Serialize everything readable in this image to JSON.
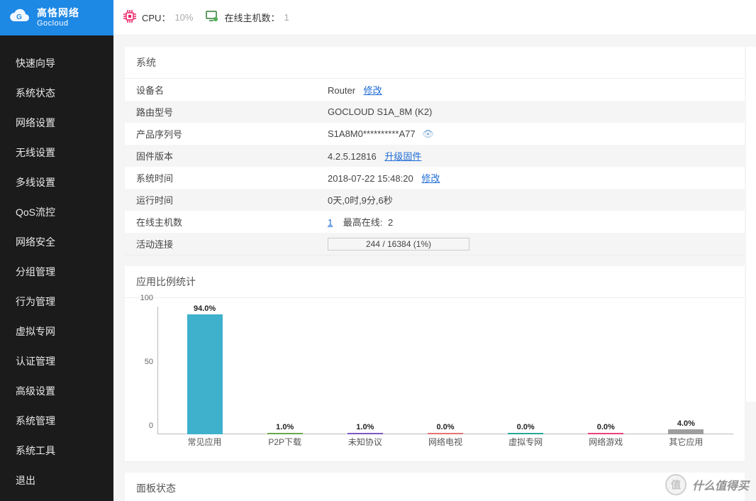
{
  "brand": {
    "cn": "高恪网络",
    "en": "Gocloud"
  },
  "topbar": {
    "cpu_label": "CPU：",
    "cpu_value": "10%",
    "online_label": "在线主机数：",
    "online_value": "1"
  },
  "sidebar": {
    "items": [
      "快速向导",
      "系统状态",
      "网络设置",
      "无线设置",
      "多线设置",
      "QoS流控",
      "网络安全",
      "分组管理",
      "行为管理",
      "虚拟专网",
      "认证管理",
      "高级设置",
      "系统管理",
      "系统工具",
      "退出"
    ]
  },
  "panels": {
    "system_title": "系统",
    "app_stats_title": "应用比例统计",
    "panel_status_title": "面板状态"
  },
  "system": {
    "rows": {
      "device_name_k": "设备名",
      "device_name_v": "Router",
      "device_name_edit": "修改",
      "model_k": "路由型号",
      "model_v": "GOCLOUD S1A_8M (K2)",
      "serial_k": "产品序列号",
      "serial_v": "S1A8M0**********A77",
      "fw_k": "固件版本",
      "fw_v": "4.2.5.12816",
      "fw_upgrade": "升级固件",
      "systime_k": "系统时间",
      "systime_v": "2018-07-22 15:48:20",
      "systime_edit": "修改",
      "uptime_k": "运行时间",
      "uptime_v": "0天,0时,9分,6秒",
      "online_k": "在线主机数",
      "online_v": "1",
      "online_max_label": "最高在线:",
      "online_max_v": "2",
      "conn_k": "活动连接",
      "conn_v": "244 / 16384 (1%)"
    }
  },
  "chart_data": {
    "type": "bar",
    "title": "应用比例统计",
    "ylabel": "",
    "ylim": [
      0,
      100
    ],
    "yticks": [
      0,
      50,
      100
    ],
    "categories": [
      "常见应用",
      "P2P下载",
      "未知协议",
      "网络电视",
      "虚拟专网",
      "网络游戏",
      "其它应用"
    ],
    "values": [
      94.0,
      1.0,
      1.0,
      0.0,
      0.0,
      0.0,
      4.0
    ],
    "value_labels": [
      "94.0%",
      "1.0%",
      "1.0%",
      "0.0%",
      "0.0%",
      "0.0%",
      "4.0%"
    ],
    "colors": [
      "#3fb1cc",
      "#6aa84f",
      "#7e57c2",
      "#e57373",
      "#26a69a",
      "#ec407a",
      "#9e9e9e"
    ]
  },
  "watermark": {
    "text": "什么值得买"
  }
}
